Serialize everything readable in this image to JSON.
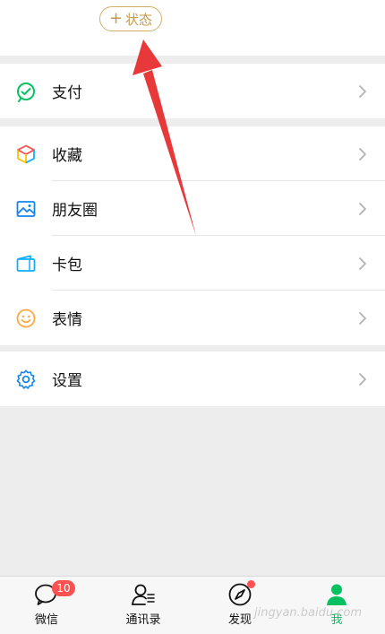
{
  "status_button": {
    "plus": "+",
    "label": "状态"
  },
  "menu": {
    "pay": {
      "label": "支付"
    },
    "favorites": {
      "label": "收藏"
    },
    "moments": {
      "label": "朋友圈"
    },
    "cards": {
      "label": "卡包"
    },
    "stickers": {
      "label": "表情"
    },
    "settings": {
      "label": "设置"
    }
  },
  "tabbar": {
    "chats": {
      "label": "微信",
      "badge": "10"
    },
    "contacts": {
      "label": "通讯录"
    },
    "discover": {
      "label": "发现"
    },
    "me": {
      "label": "我"
    }
  },
  "watermark": {
    "text": "jingyan.baidu.com"
  },
  "colors": {
    "accent_green": "#07c160",
    "badge_red": "#fa5151",
    "status_gold": "#c39a4c",
    "annotation_red": "#e8393a"
  }
}
